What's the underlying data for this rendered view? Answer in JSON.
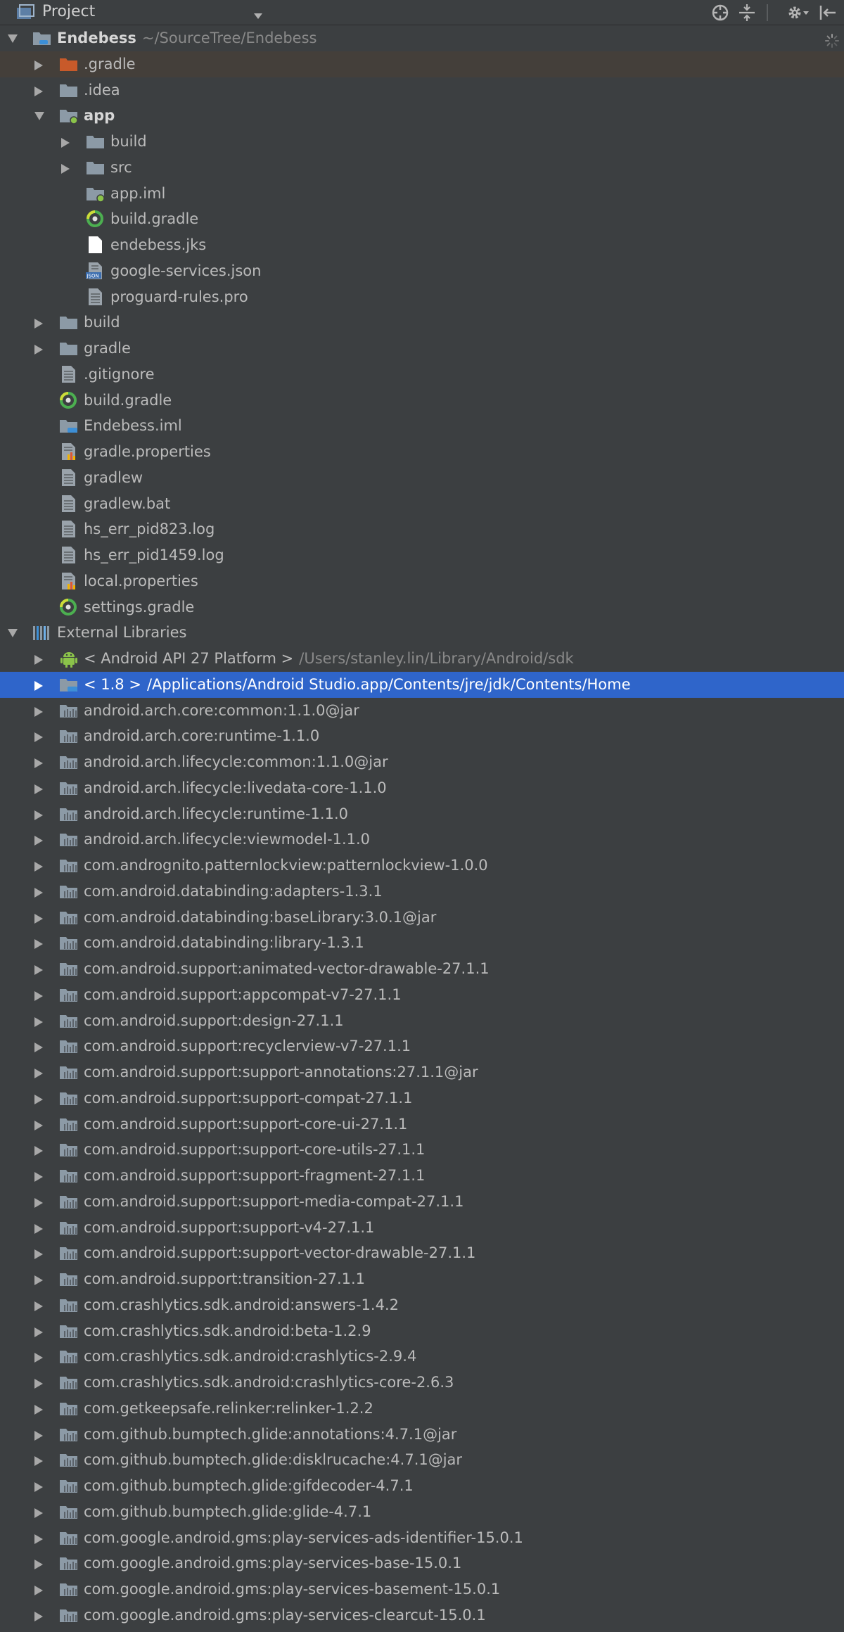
{
  "header": {
    "title": "Project",
    "dropdown_icon": "chevron-down-icon",
    "tool_icons": [
      "crosshair-icon",
      "collapse-all-icon",
      "gear-icon",
      "hide-panel-icon"
    ]
  },
  "root": {
    "name": "Endebess",
    "path": "~/SourceTree/Endebess"
  },
  "rows": [
    {
      "text": ".gradle",
      "depth": 1,
      "arrow": "right",
      "icon": "folder-orange",
      "modified": true
    },
    {
      "text": ".idea",
      "depth": 1,
      "arrow": "right",
      "icon": "folder"
    },
    {
      "text": "app",
      "depth": 1,
      "arrow": "down",
      "icon": "module-folder",
      "bold": true
    },
    {
      "text": "build",
      "depth": 2,
      "arrow": "right",
      "icon": "folder"
    },
    {
      "text": "src",
      "depth": 2,
      "arrow": "right",
      "icon": "folder"
    },
    {
      "text": "app.iml",
      "depth": 2,
      "arrow": "none",
      "icon": "module-folder"
    },
    {
      "text": "build.gradle",
      "depth": 2,
      "arrow": "none",
      "icon": "gradle"
    },
    {
      "text": "endebess.jks",
      "depth": 2,
      "arrow": "none",
      "icon": "file-white"
    },
    {
      "text": "google-services.json",
      "depth": 2,
      "arrow": "none",
      "icon": "json"
    },
    {
      "text": "proguard-rules.pro",
      "depth": 2,
      "arrow": "none",
      "icon": "text-file"
    },
    {
      "text": "build",
      "depth": 1,
      "arrow": "right",
      "icon": "folder"
    },
    {
      "text": "gradle",
      "depth": 1,
      "arrow": "right",
      "icon": "folder"
    },
    {
      "text": ".gitignore",
      "depth": 1,
      "arrow": "none",
      "icon": "text-file"
    },
    {
      "text": "build.gradle",
      "depth": 1,
      "arrow": "none",
      "icon": "gradle"
    },
    {
      "text": "Endebess.iml",
      "depth": 1,
      "arrow": "none",
      "icon": "iml-folder"
    },
    {
      "text": "gradle.properties",
      "depth": 1,
      "arrow": "none",
      "icon": "properties"
    },
    {
      "text": "gradlew",
      "depth": 1,
      "arrow": "none",
      "icon": "text-file"
    },
    {
      "text": "gradlew.bat",
      "depth": 1,
      "arrow": "none",
      "icon": "text-file"
    },
    {
      "text": "hs_err_pid823.log",
      "depth": 1,
      "arrow": "none",
      "icon": "text-file"
    },
    {
      "text": "hs_err_pid1459.log",
      "depth": 1,
      "arrow": "none",
      "icon": "text-file"
    },
    {
      "text": "local.properties",
      "depth": 1,
      "arrow": "none",
      "icon": "properties"
    },
    {
      "text": "settings.gradle",
      "depth": 1,
      "arrow": "none",
      "icon": "gradle"
    },
    {
      "text": "External Libraries",
      "depth": 0,
      "arrow": "down",
      "icon": "libraries"
    },
    {
      "text": "< Android API 27 Platform >",
      "path": "/Users/stanley.lin/Library/Android/sdk",
      "depth": 1,
      "arrow": "right",
      "icon": "android"
    },
    {
      "text": "< 1.8 >",
      "path": "/Applications/Android Studio.app/Contents/jre/jdk/Contents/Home",
      "depth": 1,
      "arrow": "right",
      "icon": "jdk-folder",
      "selected": true
    },
    {
      "text": "android.arch.core:common:1.1.0@jar",
      "depth": 1,
      "arrow": "right",
      "icon": "library"
    },
    {
      "text": "android.arch.core:runtime-1.1.0",
      "depth": 1,
      "arrow": "right",
      "icon": "library"
    },
    {
      "text": "android.arch.lifecycle:common:1.1.0@jar",
      "depth": 1,
      "arrow": "right",
      "icon": "library"
    },
    {
      "text": "android.arch.lifecycle:livedata-core-1.1.0",
      "depth": 1,
      "arrow": "right",
      "icon": "library"
    },
    {
      "text": "android.arch.lifecycle:runtime-1.1.0",
      "depth": 1,
      "arrow": "right",
      "icon": "library"
    },
    {
      "text": "android.arch.lifecycle:viewmodel-1.1.0",
      "depth": 1,
      "arrow": "right",
      "icon": "library"
    },
    {
      "text": "com.andrognito.patternlockview:patternlockview-1.0.0",
      "depth": 1,
      "arrow": "right",
      "icon": "library"
    },
    {
      "text": "com.android.databinding:adapters-1.3.1",
      "depth": 1,
      "arrow": "right",
      "icon": "library"
    },
    {
      "text": "com.android.databinding:baseLibrary:3.0.1@jar",
      "depth": 1,
      "arrow": "right",
      "icon": "library"
    },
    {
      "text": "com.android.databinding:library-1.3.1",
      "depth": 1,
      "arrow": "right",
      "icon": "library"
    },
    {
      "text": "com.android.support:animated-vector-drawable-27.1.1",
      "depth": 1,
      "arrow": "right",
      "icon": "library"
    },
    {
      "text": "com.android.support:appcompat-v7-27.1.1",
      "depth": 1,
      "arrow": "right",
      "icon": "library"
    },
    {
      "text": "com.android.support:design-27.1.1",
      "depth": 1,
      "arrow": "right",
      "icon": "library"
    },
    {
      "text": "com.android.support:recyclerview-v7-27.1.1",
      "depth": 1,
      "arrow": "right",
      "icon": "library"
    },
    {
      "text": "com.android.support:support-annotations:27.1.1@jar",
      "depth": 1,
      "arrow": "right",
      "icon": "library"
    },
    {
      "text": "com.android.support:support-compat-27.1.1",
      "depth": 1,
      "arrow": "right",
      "icon": "library"
    },
    {
      "text": "com.android.support:support-core-ui-27.1.1",
      "depth": 1,
      "arrow": "right",
      "icon": "library"
    },
    {
      "text": "com.android.support:support-core-utils-27.1.1",
      "depth": 1,
      "arrow": "right",
      "icon": "library"
    },
    {
      "text": "com.android.support:support-fragment-27.1.1",
      "depth": 1,
      "arrow": "right",
      "icon": "library"
    },
    {
      "text": "com.android.support:support-media-compat-27.1.1",
      "depth": 1,
      "arrow": "right",
      "icon": "library"
    },
    {
      "text": "com.android.support:support-v4-27.1.1",
      "depth": 1,
      "arrow": "right",
      "icon": "library"
    },
    {
      "text": "com.android.support:support-vector-drawable-27.1.1",
      "depth": 1,
      "arrow": "right",
      "icon": "library"
    },
    {
      "text": "com.android.support:transition-27.1.1",
      "depth": 1,
      "arrow": "right",
      "icon": "library"
    },
    {
      "text": "com.crashlytics.sdk.android:answers-1.4.2",
      "depth": 1,
      "arrow": "right",
      "icon": "library"
    },
    {
      "text": "com.crashlytics.sdk.android:beta-1.2.9",
      "depth": 1,
      "arrow": "right",
      "icon": "library"
    },
    {
      "text": "com.crashlytics.sdk.android:crashlytics-2.9.4",
      "depth": 1,
      "arrow": "right",
      "icon": "library"
    },
    {
      "text": "com.crashlytics.sdk.android:crashlytics-core-2.6.3",
      "depth": 1,
      "arrow": "right",
      "icon": "library"
    },
    {
      "text": "com.getkeepsafe.relinker:relinker-1.2.2",
      "depth": 1,
      "arrow": "right",
      "icon": "library"
    },
    {
      "text": "com.github.bumptech.glide:annotations:4.7.1@jar",
      "depth": 1,
      "arrow": "right",
      "icon": "library"
    },
    {
      "text": "com.github.bumptech.glide:disklrucache:4.7.1@jar",
      "depth": 1,
      "arrow": "right",
      "icon": "library"
    },
    {
      "text": "com.github.bumptech.glide:gifdecoder-4.7.1",
      "depth": 1,
      "arrow": "right",
      "icon": "library"
    },
    {
      "text": "com.github.bumptech.glide:glide-4.7.1",
      "depth": 1,
      "arrow": "right",
      "icon": "library"
    },
    {
      "text": "com.google.android.gms:play-services-ads-identifier-15.0.1",
      "depth": 1,
      "arrow": "right",
      "icon": "library"
    },
    {
      "text": "com.google.android.gms:play-services-base-15.0.1",
      "depth": 1,
      "arrow": "right",
      "icon": "library"
    },
    {
      "text": "com.google.android.gms:play-services-basement-15.0.1",
      "depth": 1,
      "arrow": "right",
      "icon": "library"
    },
    {
      "text": "com.google.android.gms:play-services-clearcut-15.0.1",
      "depth": 1,
      "arrow": "right",
      "icon": "library"
    }
  ]
}
